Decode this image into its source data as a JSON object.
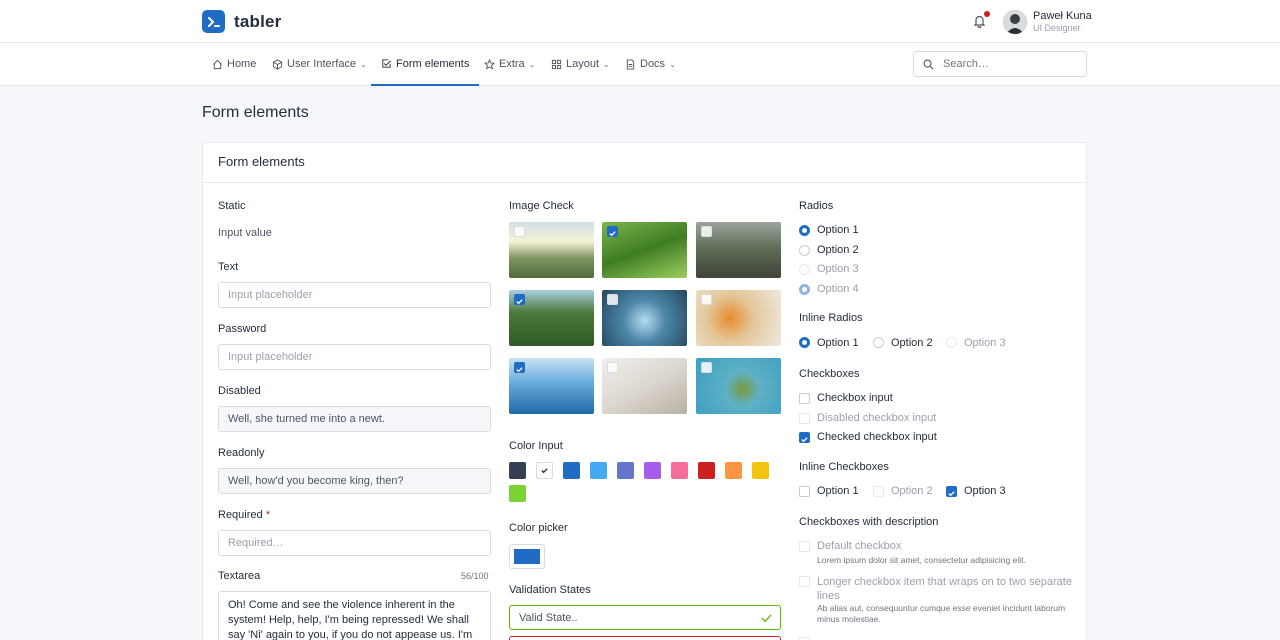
{
  "brand": {
    "name": "tabler"
  },
  "user": {
    "name": "Paweł Kuna",
    "role": "UI Designer"
  },
  "nav": {
    "items": [
      {
        "label": "Home",
        "icon": "home-icon"
      },
      {
        "label": "User Interface",
        "icon": "package-icon"
      },
      {
        "label": "Form elements",
        "icon": "checkbox-icon"
      },
      {
        "label": "Extra",
        "icon": "star-icon"
      },
      {
        "label": "Layout",
        "icon": "layout-icon"
      },
      {
        "label": "Docs",
        "icon": "file-icon"
      }
    ],
    "active": "Form elements",
    "search_placeholder": "Search…"
  },
  "page": {
    "title": "Form elements",
    "card_title": "Form elements"
  },
  "col1": {
    "static_label": "Static",
    "static_value": "Input value",
    "text_label": "Text",
    "text_placeholder": "Input placeholder",
    "password_label": "Password",
    "password_placeholder": "Input placeholder",
    "disabled_label": "Disabled",
    "disabled_value": "Well, she turned me into a newt.",
    "readonly_label": "Readonly",
    "readonly_value": "Well, how'd you become king, then?",
    "required_label": "Required",
    "required_mark": "*",
    "required_placeholder": "Required…",
    "textarea_label": "Textarea",
    "textarea_count": "56/100",
    "textarea_value": "Oh! Come and see the violence inherent in the system! Help, help, I'm being repressed! We shall say 'Ni' again to you, if you do not appease us. I'm not a"
  },
  "col2": {
    "image_check_label": "Image Check",
    "images_checked": [
      false,
      true,
      false,
      true,
      false,
      false,
      true,
      false,
      false
    ],
    "color_input_label": "Color Input",
    "swatches": [
      "#354052",
      "#ffffff",
      "#206bc4",
      "#45aaf2",
      "#6574cd",
      "#a55eea",
      "#f66d9b",
      "#cd201f",
      "#fd9644",
      "#f1c40f",
      "#7bd235"
    ],
    "color_picker_label": "Color picker",
    "color_picker_value": "#206bc4",
    "validation_label": "Validation States",
    "valid_placeholder": "Valid State.."
  },
  "col3": {
    "radios_label": "Radios",
    "radios": [
      "Option 1",
      "Option 2",
      "Option 3",
      "Option 4"
    ],
    "inline_radios_label": "Inline Radios",
    "inline_radios": [
      "Option 1",
      "Option 2",
      "Option 3"
    ],
    "checkboxes_label": "Checkboxes",
    "checkboxes": [
      "Checkbox input",
      "Disabled checkbox input",
      "Checked checkbox input"
    ],
    "inline_checkboxes_label": "Inline Checkboxes",
    "inline_checkboxes": [
      "Option 1",
      "Option 2",
      "Option 3"
    ],
    "desc_label": "Checkboxes with description",
    "desc_items": [
      {
        "title": "Default checkbox",
        "desc": "Lorem ipsum dolor sit amet, consectetur adipisicing elit."
      },
      {
        "title": "Longer checkbox item that wraps on to two separate lines",
        "desc": "Ab alias aut, consequuntur cumque esse eveniet incidunt laborum minus molestiae."
      }
    ]
  }
}
